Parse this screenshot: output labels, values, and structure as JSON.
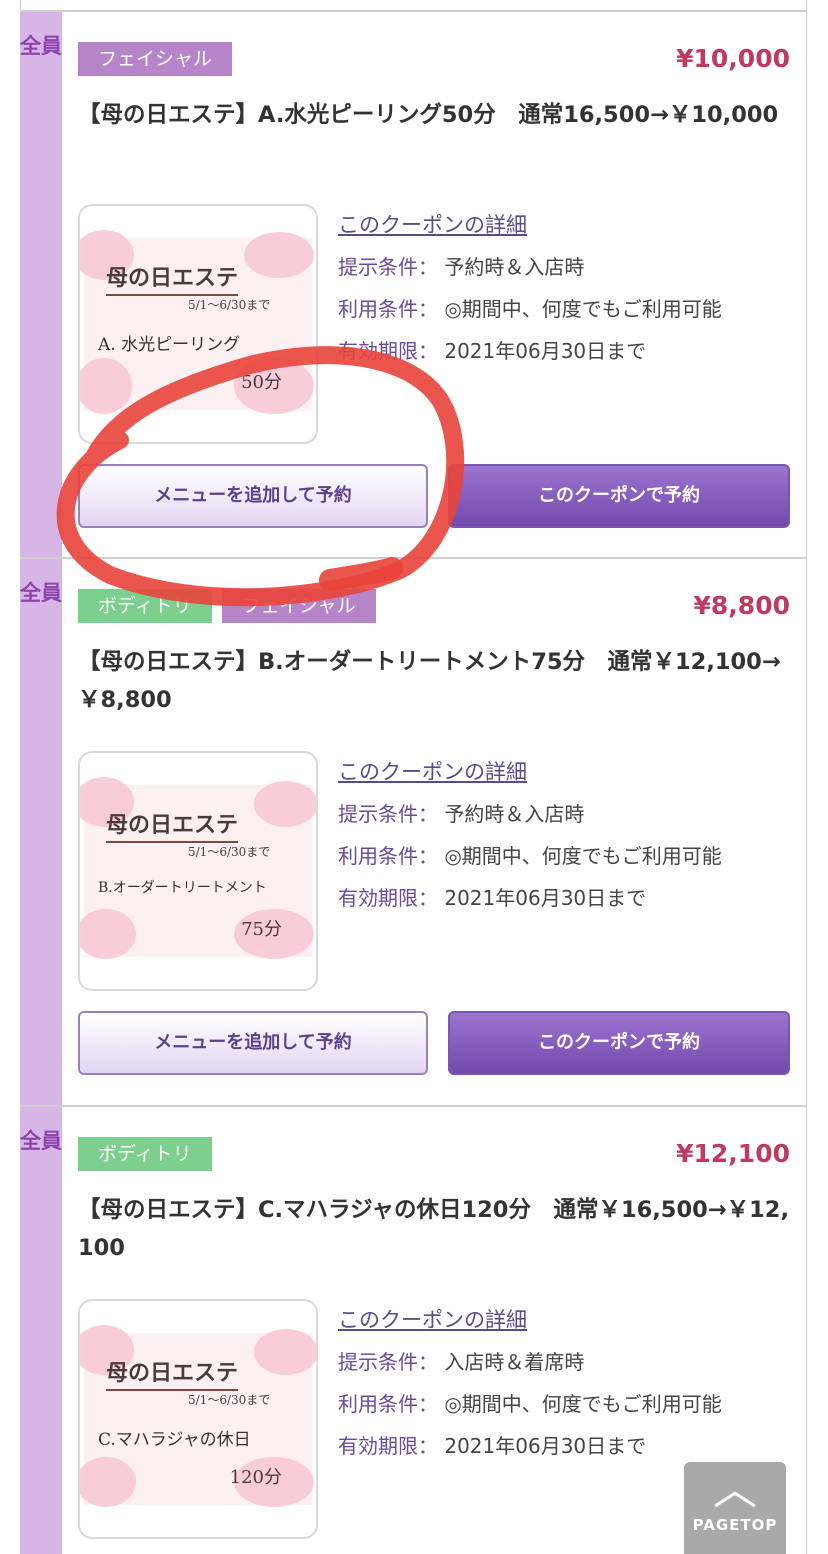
{
  "coupons": [
    {
      "member_label": "全員",
      "tags": [
        {
          "label": "フェイシャル",
          "type": "facial"
        }
      ],
      "price": "¥10,000",
      "title": "【母の日エステ】A.水光ピーリング50分　通常16,500→￥10,000",
      "image": {
        "heading": "母の日エステ",
        "period": "5/1～6/30まで",
        "menu": "A. 水光ピーリング",
        "duration": "50分"
      },
      "detail_link": "このクーポンの詳細",
      "conditions": [
        {
          "key": "提示条件：",
          "value": "予約時＆入店時"
        },
        {
          "key": "利用条件：",
          "value": "◎期間中、何度でもご利用可能"
        },
        {
          "key": "有効期限：",
          "value": "2021年06月30日まで"
        }
      ],
      "btn_add": "メニューを追加して予約",
      "btn_coupon": "このクーポンで予約"
    },
    {
      "member_label": "全員",
      "tags": [
        {
          "label": "ボディトリ",
          "type": "body"
        },
        {
          "label": "フェイシャル",
          "type": "facial"
        }
      ],
      "price": "¥8,800",
      "title": "【母の日エステ】B.オーダートリートメント75分　通常￥12,100→￥8,800",
      "image": {
        "heading": "母の日エステ",
        "period": "5/1～6/30まで",
        "menu": "B.オーダートリートメント",
        "duration": "75分"
      },
      "detail_link": "このクーポンの詳細",
      "conditions": [
        {
          "key": "提示条件：",
          "value": "予約時＆入店時"
        },
        {
          "key": "利用条件：",
          "value": "◎期間中、何度でもご利用可能"
        },
        {
          "key": "有効期限：",
          "value": "2021年06月30日まで"
        }
      ],
      "btn_add": "メニューを追加して予約",
      "btn_coupon": "このクーポンで予約"
    },
    {
      "member_label": "全員",
      "tags": [
        {
          "label": "ボディトリ",
          "type": "body"
        }
      ],
      "price": "¥12,100",
      "title": "【母の日エステ】C.マハラジャの休日120分　通常￥16,500→￥12,100",
      "image": {
        "heading": "母の日エステ",
        "period": "5/1～6/30まで",
        "menu": "C.マハラジャの休日",
        "duration": "120分"
      },
      "detail_link": "このクーポンの詳細",
      "conditions": [
        {
          "key": "提示条件：",
          "value": "入店時＆着席時"
        },
        {
          "key": "利用条件：",
          "value": "◎期間中、何度でもご利用可能"
        },
        {
          "key": "有効期限：",
          "value": "2021年06月30日まで"
        }
      ]
    }
  ],
  "pagetop": {
    "label": "PAGETOP"
  },
  "colors": {
    "price": "#c0395f",
    "side": "#d7b5e6",
    "facial_tag": "#b685c9",
    "body_tag": "#7ccf8c",
    "annotation": "#e8443a"
  }
}
